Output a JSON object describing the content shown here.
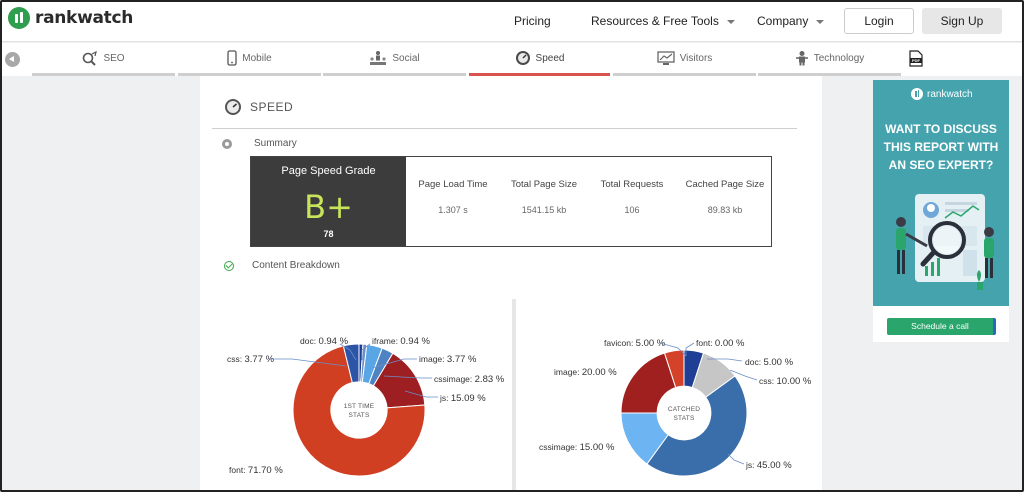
{
  "brand": {
    "name": "rankwatch"
  },
  "topnav": {
    "pricing": "Pricing",
    "resources": "Resources & Free Tools",
    "company": "Company",
    "login": "Login",
    "signup": "Sign Up"
  },
  "tabs": [
    {
      "label": "SEO",
      "icon": "seo-icon"
    },
    {
      "label": "Mobile",
      "icon": "mobile-icon"
    },
    {
      "label": "Social",
      "icon": "social-icon"
    },
    {
      "label": "Speed",
      "icon": "speedometer-icon",
      "active": true
    },
    {
      "label": "Visitors",
      "icon": "visitors-icon"
    },
    {
      "label": "Technology",
      "icon": "technology-icon"
    },
    {
      "label": "",
      "icon": "pdf-icon"
    }
  ],
  "section": {
    "title": "SPEED",
    "summary_label": "Summary",
    "breakdown_label": "Content Breakdown"
  },
  "summary": {
    "grade_title": "Page Speed Grade",
    "grade": "B+",
    "score": "78",
    "metrics": [
      {
        "label": "Page Load Time",
        "value": "1.307 s"
      },
      {
        "label": "Total Page Size",
        "value": "1541.15 kb"
      },
      {
        "label": "Total Requests",
        "value": "106"
      },
      {
        "label": "Cached Page Size",
        "value": "89.83 kb"
      }
    ]
  },
  "colors": {
    "accent_tab": "#d9534f",
    "grade_text": "#c8e45a",
    "ad_background": "#44a3ad",
    "ad_button": "#2aa66c"
  },
  "chart_data": [
    {
      "type": "pie",
      "center_label": [
        "1ST TIME",
        "STATS"
      ],
      "slices": [
        {
          "name": "doc",
          "label": "0.94 %",
          "value": 0.94,
          "color": "#1a3f95"
        },
        {
          "name": "iframe",
          "label": "0.94 %",
          "value": 0.94,
          "color": "#6d8ec4"
        },
        {
          "name": "image",
          "label": "3.77 %",
          "value": 3.77,
          "color": "#59a6e6"
        },
        {
          "name": "cssimage",
          "label": "2.83 %",
          "value": 2.83,
          "color": "#4f84c4"
        },
        {
          "name": "js",
          "label": "15.09 %",
          "value": 15.09,
          "color": "#9e1f22"
        },
        {
          "name": "font",
          "label": "71.70 %",
          "value": 71.7,
          "color": "#d13f22"
        },
        {
          "name": "css",
          "label": "3.77 %",
          "value": 3.77,
          "color": "#2c55a8"
        }
      ]
    },
    {
      "type": "pie",
      "center_label": [
        "CATCHED",
        "STATS"
      ],
      "slices": [
        {
          "name": "font",
          "label": "0.00 %",
          "value": 0.0,
          "color": "#c43a22"
        },
        {
          "name": "doc",
          "label": "5.00 %",
          "value": 5.0,
          "color": "#1f3f96"
        },
        {
          "name": "css",
          "label": "10.00 %",
          "value": 10.0,
          "color": "#c6c6c6"
        },
        {
          "name": "js",
          "label": "45.00 %",
          "value": 45.0,
          "color": "#3a6eaa"
        },
        {
          "name": "cssimage",
          "label": "15.00 %",
          "value": 15.0,
          "color": "#6db4f2"
        },
        {
          "name": "image",
          "label": "20.00 %",
          "value": 20.0,
          "color": "#a0201f"
        },
        {
          "name": "favicon",
          "label": "5.00 %",
          "value": 5.0,
          "color": "#d4422a"
        }
      ]
    }
  ],
  "ad": {
    "brand": "rankwatch",
    "title_lines": [
      "WANT TO DISCUSS",
      "THIS REPORT WITH",
      "AN SEO EXPERT?"
    ],
    "cta": "Schedule a call"
  }
}
